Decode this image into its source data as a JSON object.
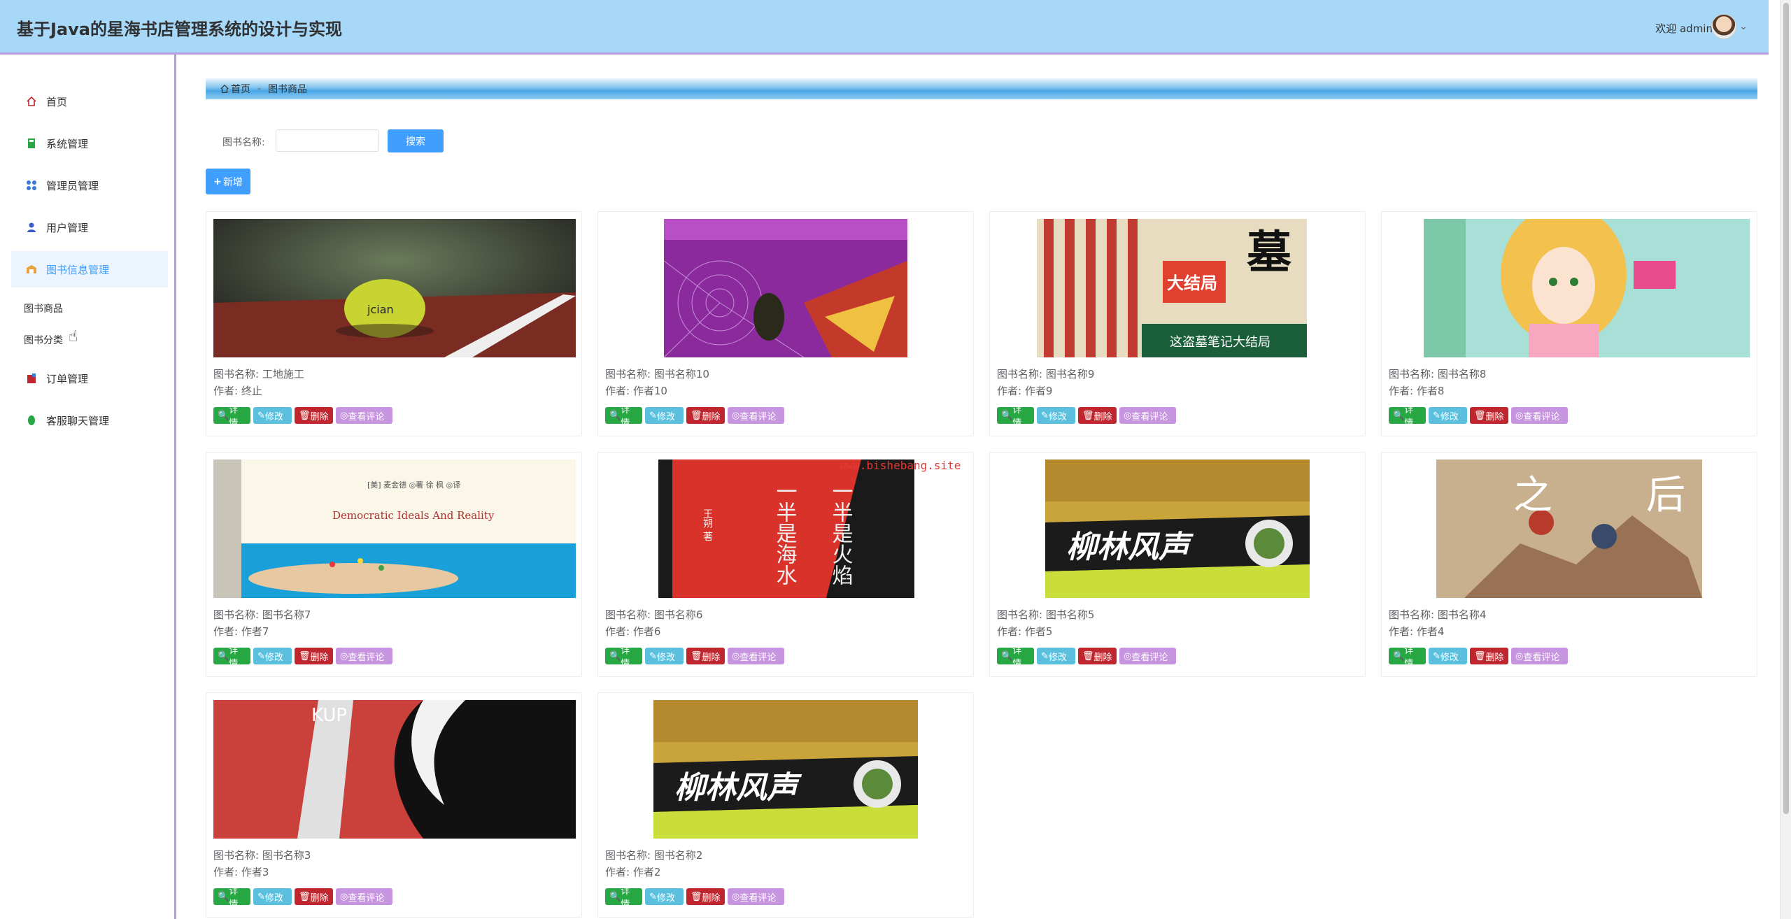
{
  "app_title": "基于Java的星海书店管理系统的设计与实现",
  "header": {
    "welcome": "欢迎 admin",
    "caret": "⌄"
  },
  "sidebar": {
    "items": [
      {
        "label": "首页",
        "icon": "home-icon"
      },
      {
        "label": "系统管理",
        "icon": "book-icon"
      },
      {
        "label": "管理员管理",
        "icon": "grid-icon"
      },
      {
        "label": "用户管理",
        "icon": "user-icon"
      },
      {
        "label": "图书信息管理",
        "icon": "box-icon"
      },
      {
        "label": "订单管理",
        "icon": "order-icon"
      },
      {
        "label": "客服聊天管理",
        "icon": "chat-icon"
      }
    ],
    "subitems": [
      "图书商品",
      "图书分类"
    ]
  },
  "breadcrumb": {
    "home": "首页",
    "sep": "-",
    "current": "图书商品"
  },
  "search": {
    "label": "图书名称:",
    "value": "",
    "button": "搜索"
  },
  "add_button": "新增",
  "book_label": "图书名称:",
  "author_label": "作者:",
  "actions": {
    "detail": "详情",
    "edit": "修改",
    "delete": "删除",
    "review": "查看评论"
  },
  "books": [
    {
      "name": "工地施工",
      "author": "终止"
    },
    {
      "name": "图书名称10",
      "author": "作者10"
    },
    {
      "name": "图书名称9",
      "author": "作者9"
    },
    {
      "name": "图书名称8",
      "author": "作者8"
    },
    {
      "name": "图书名称7",
      "author": "作者7"
    },
    {
      "name": "图书名称6",
      "author": "作者6"
    },
    {
      "name": "图书名称5",
      "author": "作者5"
    },
    {
      "name": "图书名称4",
      "author": "作者4"
    },
    {
      "name": "图书名称3",
      "author": "作者3"
    },
    {
      "name": "图书名称2",
      "author": "作者2"
    }
  ],
  "cover_text": {
    "c1": "jcian",
    "c3a": "墓",
    "c3b": "大结局",
    "c3c": "这盗墓笔记大结局",
    "c5a": "[美] 麦金德 ◎著  徐 枫 ◎译",
    "c5b": "Democratic Ideals And Reality",
    "c6a": "一半是火焰",
    "c6b": "一半是海水",
    "c6c": "王朔 著",
    "c7": "柳林风声",
    "c8a": "之",
    "c8b": "后",
    "c9": "KUP",
    "c10": "柳林风声"
  },
  "watermark": "www.bishebang.site"
}
